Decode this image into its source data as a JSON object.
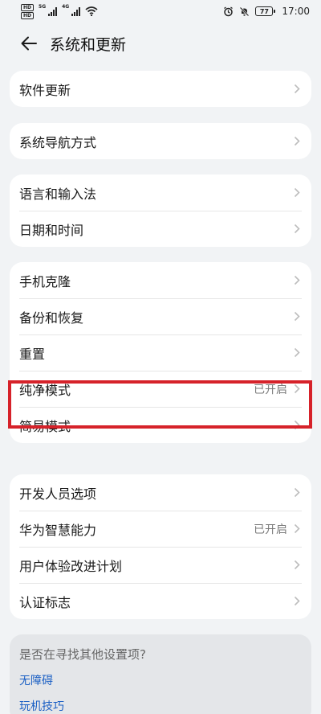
{
  "status_bar": {
    "sim1": "HD",
    "sim2": "HD",
    "net1": "5G",
    "net2": "4G",
    "battery": "77",
    "time": "17:00"
  },
  "header": {
    "title": "系统和更新"
  },
  "groups": [
    {
      "items": [
        {
          "label": "软件更新",
          "value": ""
        }
      ]
    },
    {
      "items": [
        {
          "label": "系统导航方式",
          "value": ""
        }
      ]
    },
    {
      "items": [
        {
          "label": "语言和输入法",
          "value": ""
        },
        {
          "label": "日期和时间",
          "value": ""
        }
      ]
    },
    {
      "items": [
        {
          "label": "手机克隆",
          "value": ""
        },
        {
          "label": "备份和恢复",
          "value": ""
        },
        {
          "label": "重置",
          "value": ""
        },
        {
          "label": "纯净模式",
          "value": "已开启"
        },
        {
          "label": "简易模式",
          "value": ""
        }
      ]
    },
    {
      "items": [
        {
          "label": "开发人员选项",
          "value": ""
        },
        {
          "label": "华为智慧能力",
          "value": "已开启"
        },
        {
          "label": "用户体验改进计划",
          "value": ""
        },
        {
          "label": "认证标志",
          "value": ""
        }
      ]
    }
  ],
  "suggest": {
    "title": "是否在寻找其他设置项?",
    "links": [
      "无障碍",
      "玩机技巧"
    ]
  },
  "colors": {
    "background": "#f1f3f5",
    "card": "#ffffff",
    "highlight": "#d6222a",
    "link": "#1a5fc4"
  }
}
